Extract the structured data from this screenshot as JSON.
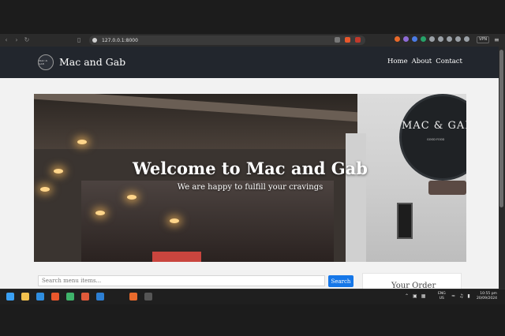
{
  "browser": {
    "url": "127.0.0.1:8000",
    "vpn_label": "VPN"
  },
  "site": {
    "brand": "Mac and Gab",
    "logo_text": "MAC & GAB",
    "nav": [
      {
        "label": "Home"
      },
      {
        "label": "About"
      },
      {
        "label": "Contact"
      }
    ]
  },
  "hero": {
    "title": "Welcome to Mac and Gab",
    "subtitle": "We are happy to fulfill your cravings",
    "sign_text": "MAC & GAB",
    "sign_sub": "GOOD FOOD"
  },
  "search": {
    "placeholder": "Search menu items...",
    "button_label": "Search"
  },
  "order": {
    "title": "Your Order"
  },
  "taskbar": {
    "lang_line1": "ENG",
    "lang_line2": "US",
    "time": "10:55 pm",
    "date": "20/09/2024"
  },
  "colors": {
    "navbar_bg": "#22262d",
    "search_button": "#1677e8",
    "page_bg": "#f2f2f2"
  }
}
